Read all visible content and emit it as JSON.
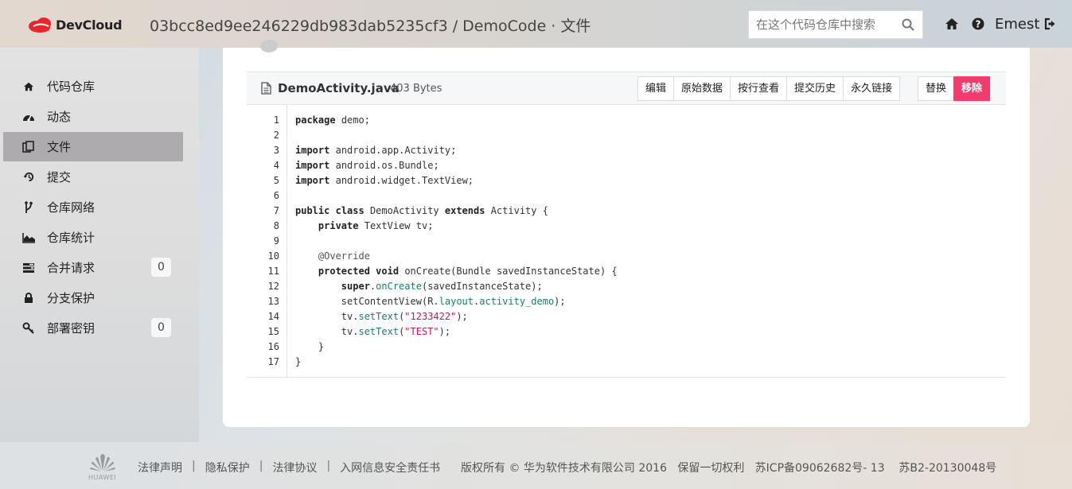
{
  "header": {
    "brand": "DevCloud",
    "repo_path": "03bcc8ed9ee246229db983dab5235cf3 / DemoCode · 文件",
    "search_placeholder": "在这个代码仓库中搜索",
    "user_name": "Emest",
    "brand_color": "#e8262c"
  },
  "sidebar": {
    "items": [
      {
        "label": "代码仓库",
        "icon": "home-icon"
      },
      {
        "label": "动态",
        "icon": "dashboard-icon"
      },
      {
        "label": "文件",
        "icon": "copy-icon",
        "active": true
      },
      {
        "label": "提交",
        "icon": "history-icon"
      },
      {
        "label": "仓库网络",
        "icon": "branch-icon"
      },
      {
        "label": "仓库统计",
        "icon": "area-chart-icon"
      },
      {
        "label": "合并请求",
        "icon": "tasks-icon",
        "badge": "0"
      },
      {
        "label": "分支保护",
        "icon": "lock-icon"
      },
      {
        "label": "部署密钥",
        "icon": "key-icon",
        "badge": "0"
      }
    ]
  },
  "file": {
    "name": "DemoActivity.java",
    "size": "403 Bytes",
    "actions": [
      "编辑",
      "原始数据",
      "按行查看",
      "提交历史",
      "永久链接"
    ],
    "actions2": [
      "替换",
      "移除"
    ]
  },
  "code": {
    "lines": [
      "package demo;",
      "",
      "import android.app.Activity;",
      "import android.os.Bundle;",
      "import android.widget.TextView;",
      "",
      "public class DemoActivity extends Activity {",
      "    private TextView tv;",
      "",
      "    @Override",
      "    protected void onCreate(Bundle savedInstanceState) {",
      "        super.onCreate(savedInstanceState);",
      "        setContentView(R.layout.activity_demo);",
      "        tv.setText(\"1233422\");",
      "        tv.setText(\"TEST\");",
      "    }",
      "}"
    ]
  },
  "footer": {
    "links": [
      "法律声明",
      "隐私保护",
      "法律协议",
      "入网信息安全责任书"
    ],
    "copyright": "版权所有 © 华为软件技术有限公司 2016   保留一切权利   苏ICP备09062682号- 13    苏B2-20130048号",
    "logo_text": "HUAWEI"
  }
}
